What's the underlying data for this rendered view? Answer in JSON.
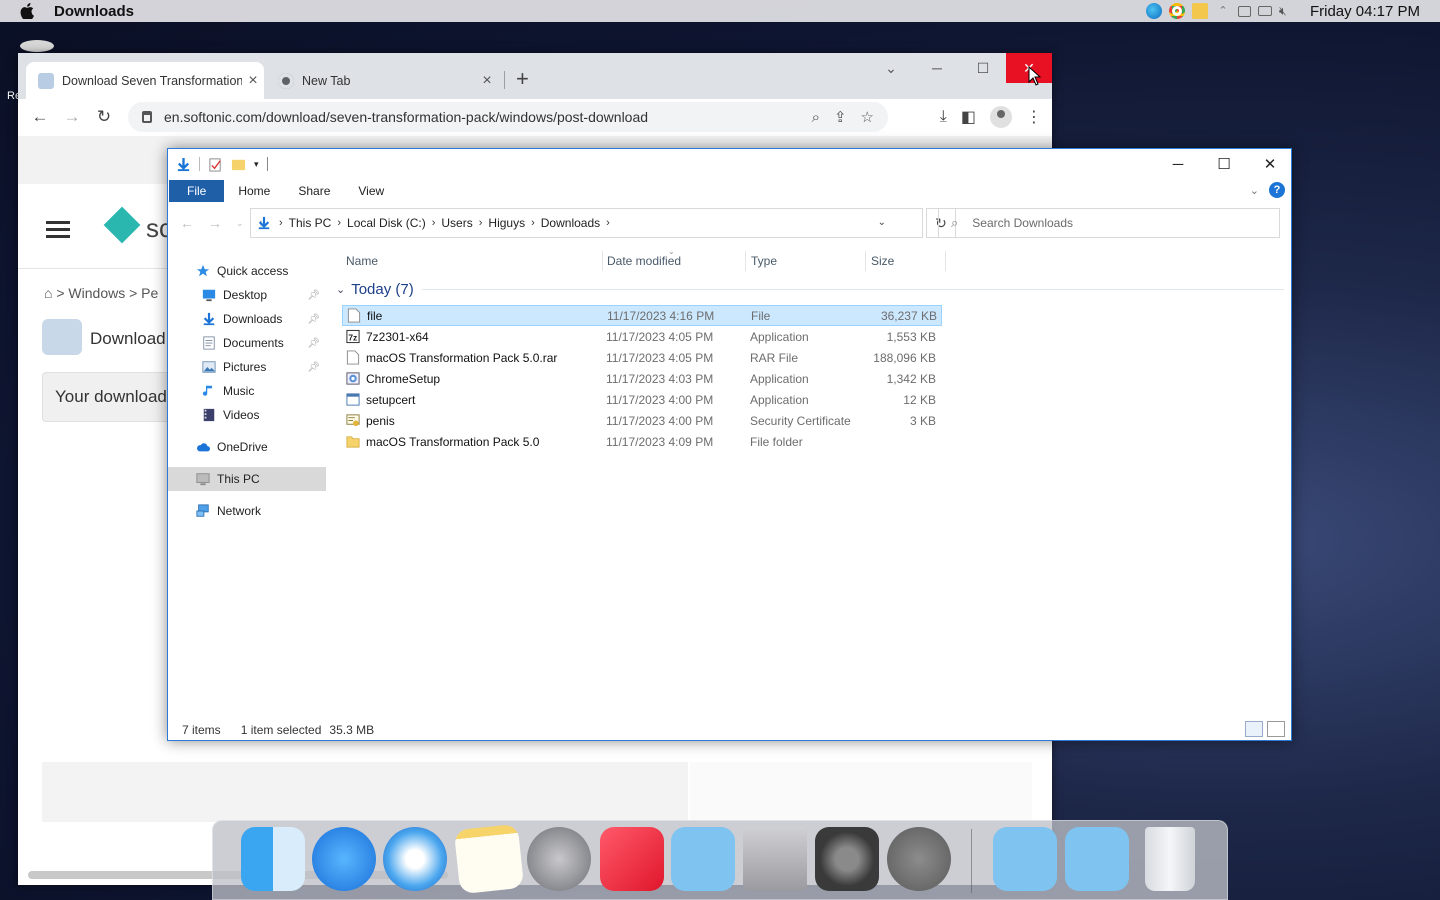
{
  "menubar": {
    "app_name": "Downloads",
    "clock": "Friday 04:17 PM"
  },
  "desktop": {
    "partial_label": "Re"
  },
  "chrome": {
    "tabs": [
      {
        "title": "Download Seven Transformation Pack",
        "active": true
      },
      {
        "title": "New Tab",
        "active": false
      }
    ],
    "url": "en.softonic.com/download/seven-transformation-pack/windows/post-download",
    "page": {
      "logo_text": "sc",
      "breadcrumb": "> Windows > Pe",
      "heading": "Download",
      "download_box": "Your download"
    }
  },
  "explorer": {
    "ribbon_tabs": [
      "File",
      "Home",
      "Share",
      "View"
    ],
    "address_path": [
      "This PC",
      "Local Disk (C:)",
      "Users",
      "Higuys",
      "Downloads"
    ],
    "search_placeholder": "Search Downloads",
    "nav": [
      {
        "label": "Quick access",
        "icon": "star-icon",
        "level": 0,
        "pinned": false
      },
      {
        "label": "Desktop",
        "icon": "desktop-icon",
        "level": 1,
        "pinned": true
      },
      {
        "label": "Downloads",
        "icon": "download-arrow-icon",
        "level": 1,
        "pinned": true
      },
      {
        "label": "Documents",
        "icon": "document-icon",
        "level": 1,
        "pinned": true
      },
      {
        "label": "Pictures",
        "icon": "pictures-icon",
        "level": 1,
        "pinned": true
      },
      {
        "label": "Music",
        "icon": "music-icon",
        "level": 1,
        "pinned": false
      },
      {
        "label": "Videos",
        "icon": "videos-icon",
        "level": 1,
        "pinned": false
      },
      {
        "label": "OneDrive",
        "icon": "cloud-icon",
        "level": 0,
        "pinned": false
      },
      {
        "label": "This PC",
        "icon": "computer-icon",
        "level": 0,
        "pinned": false,
        "selected": true
      },
      {
        "label": "Network",
        "icon": "network-icon",
        "level": 0,
        "pinned": false
      }
    ],
    "columns": [
      "Name",
      "Date modified",
      "Type",
      "Size"
    ],
    "group_label": "Today (7)",
    "files": [
      {
        "name": "file",
        "date": "11/17/2023 4:16 PM",
        "type": "File",
        "size": "36,237 KB",
        "icon": "blank-file-icon",
        "selected": true
      },
      {
        "name": "7z2301-x64",
        "date": "11/17/2023 4:05 PM",
        "type": "Application",
        "size": "1,553 KB",
        "icon": "7zip-icon",
        "selected": false
      },
      {
        "name": "macOS Transformation Pack 5.0.rar",
        "date": "11/17/2023 4:05 PM",
        "type": "RAR File",
        "size": "188,096 KB",
        "icon": "blank-file-icon",
        "selected": false
      },
      {
        "name": "ChromeSetup",
        "date": "11/17/2023 4:03 PM",
        "type": "Application",
        "size": "1,342 KB",
        "icon": "installer-icon",
        "selected": false
      },
      {
        "name": "setupcert",
        "date": "11/17/2023 4:00 PM",
        "type": "Application",
        "size": "12 KB",
        "icon": "app-window-icon",
        "selected": false
      },
      {
        "name": "penis",
        "date": "11/17/2023 4:00 PM",
        "type": "Security Certificate",
        "size": "3 KB",
        "icon": "certificate-icon",
        "selected": false
      },
      {
        "name": "macOS Transformation Pack 5.0",
        "date": "11/17/2023 4:09 PM",
        "type": "File folder",
        "size": "",
        "icon": "folder-icon",
        "selected": false
      }
    ],
    "status": {
      "count": "7 items",
      "selection": "1 item selected",
      "selection_size": "35.3 MB"
    }
  },
  "dock": {
    "apps": [
      "finder-icon",
      "app-store-icon",
      "safari-icon",
      "notes-icon",
      "launchpad-icon",
      "music-icon",
      "applications-folder-icon",
      "mac-pro-icon",
      "system-preferences-icon",
      "power-icon",
      "documents-folder-icon",
      "downloads-folder-icon",
      "trash-icon"
    ]
  },
  "colors": {
    "accent": "#1f5fa8",
    "selection": "#cce8ff",
    "close_red": "#e81123"
  }
}
